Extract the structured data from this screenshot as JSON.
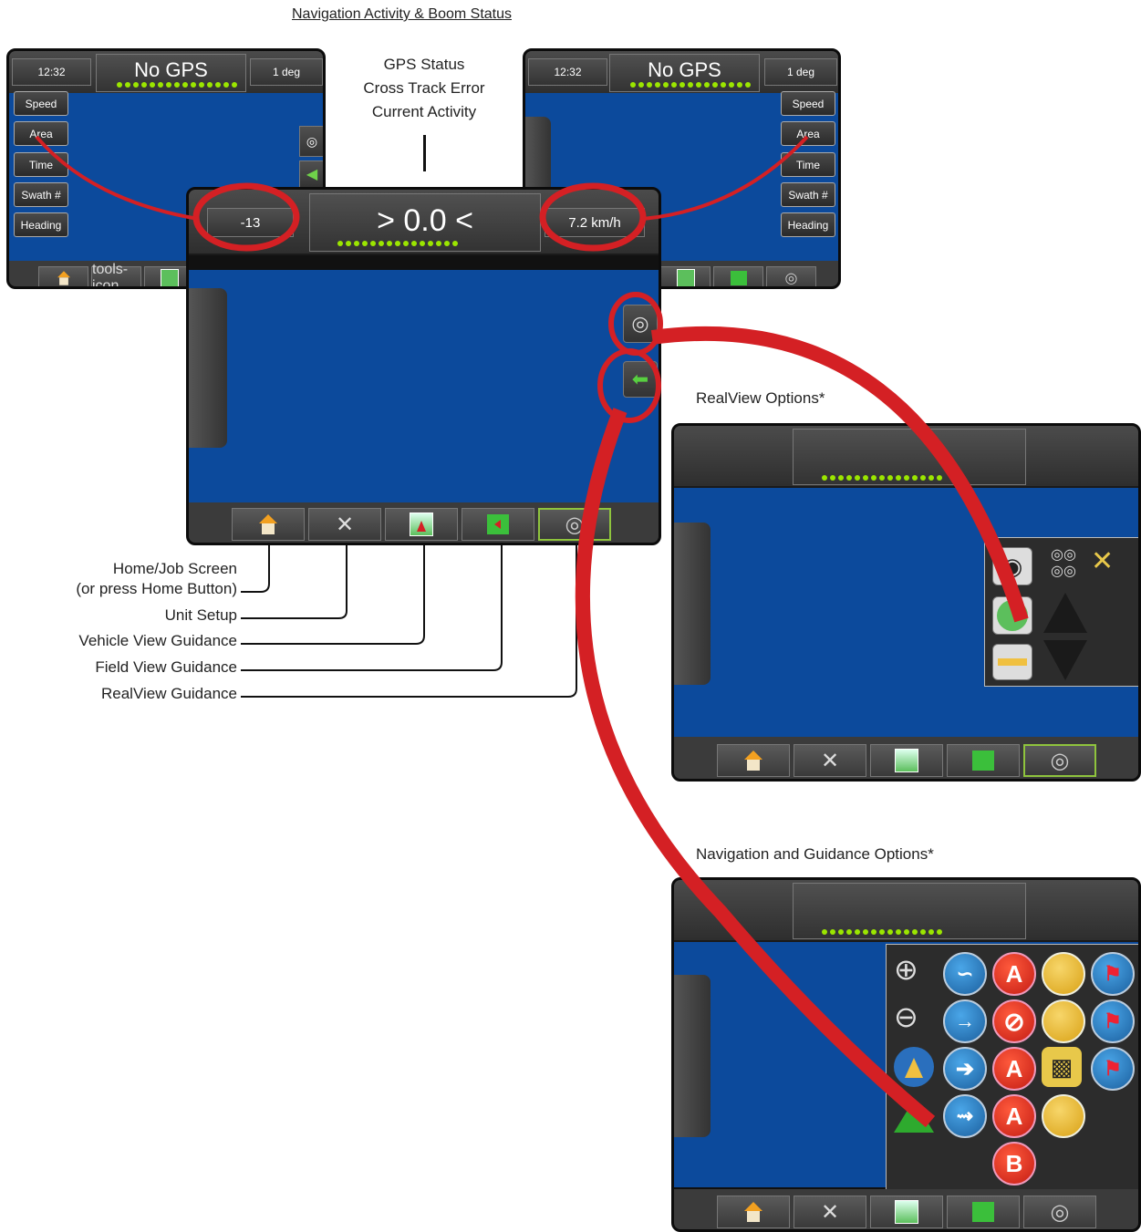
{
  "heading": "Navigation Activity & Boom Status",
  "center_labels": [
    "GPS Status",
    "Cross Track Error",
    "Current Activity"
  ],
  "side_screen": {
    "time": "12:32",
    "status": "No GPS",
    "heading_value": "1 deg",
    "buttons": [
      "Speed",
      "Area",
      "Time",
      "Swath #",
      "Heading"
    ]
  },
  "main_screen": {
    "left_value": "-13",
    "cross_track": "> 0.0 <",
    "speed": "7.2 km/h"
  },
  "legend": {
    "home_1": "Home/Job Screen",
    "home_2": "(or press Home Button)",
    "unit_setup": "Unit Setup",
    "vehicle_view": "Vehicle View Guidance",
    "field_view": "Field View Guidance",
    "realview": "RealView Guidance"
  },
  "realview_title": "RealView Options*",
  "nav_title": "Navigation and Guidance Options*",
  "nav_letters": {
    "a": "A",
    "b": "B"
  },
  "colors": {
    "field_blue": "#0c4a9c",
    "callout_red": "#d42024",
    "led_green": "#9be600"
  },
  "icons": [
    "home-icon",
    "tools-icon",
    "vehicle-view-icon",
    "field-view-icon",
    "camera-icon",
    "arrow-left-icon",
    "zoom-in-icon",
    "zoom-out-icon",
    "flag-icon",
    "checkered-flag-icon"
  ]
}
